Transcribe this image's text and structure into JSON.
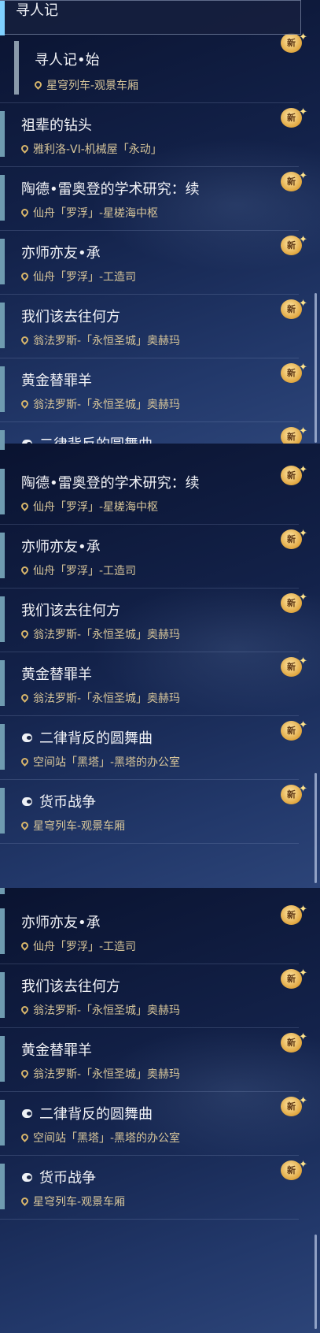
{
  "header": {
    "title": "寻人记"
  },
  "badge_label": "新",
  "first_item": {
    "title": "寻人记•始",
    "location": "星穹列车-观景车厢"
  },
  "items": [
    {
      "title": "祖辈的钻头",
      "location": "雅利洛-VI-机械屋「永动」"
    },
    {
      "title": "陶德•雷奥登的学术研究：续",
      "location": "仙舟「罗浮」-星槎海中枢"
    },
    {
      "title": "亦师亦友•承",
      "location": "仙舟「罗浮」-工造司"
    },
    {
      "title": "我们该去往何方",
      "location": "翁法罗斯-「永恒圣城」奥赫玛"
    },
    {
      "title": "黄金替罪羊",
      "location": "翁法罗斯-「永恒圣城」奥赫玛"
    },
    {
      "title": "二律背反的圆舞曲",
      "location": "空间站「黑塔」-黑塔的办公室"
    },
    {
      "title": "货币战争",
      "location": "星穹列车-观景车厢"
    }
  ],
  "colors": {
    "accent": "#7fd0ff",
    "location_text": "#d8c69a",
    "badge": "#e0a63e"
  },
  "icons": {
    "location": "map-pin-icon",
    "special_quest": "quest-type-icon",
    "new_badge": "new-badge-icon"
  }
}
